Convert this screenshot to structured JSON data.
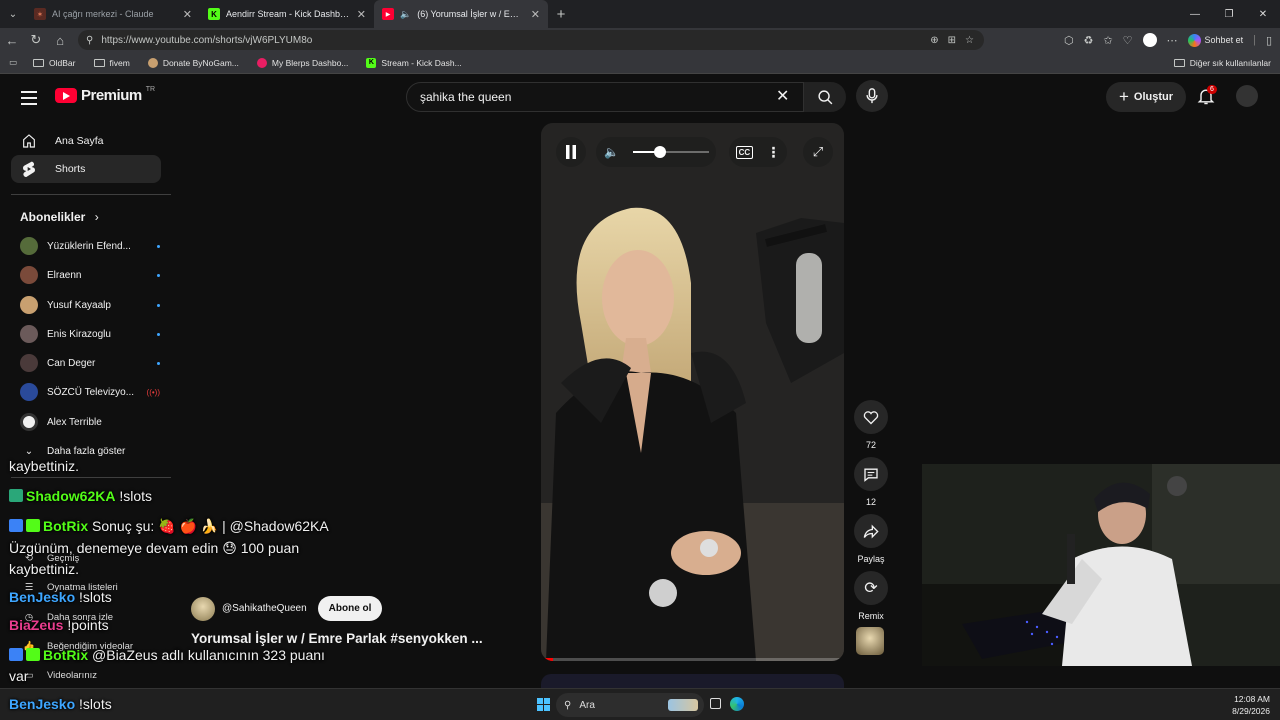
{
  "browser": {
    "tabs": [
      {
        "title": "AI çağrı merkezi - Claude",
        "icon": "claude-icon",
        "active": false
      },
      {
        "title": "Aendirr Stream - Kick Dashboard",
        "icon": "kick-icon",
        "active": false
      },
      {
        "title": "(6) Yorumsal İşler w / Emre Parlak",
        "icon": "youtube-icon",
        "active": true
      }
    ],
    "url": "https://www.youtube.com/shorts/vjW6PLYUM8o",
    "chat_button": "Sohbet et",
    "bookmarks": [
      {
        "label": "OldBar",
        "icon": "folder-icon"
      },
      {
        "label": "fivem",
        "icon": "folder-icon"
      },
      {
        "label": "Donate ByNoGam...",
        "icon": "donate-icon"
      },
      {
        "label": "My Blerps Dashbo...",
        "icon": "blerp-icon"
      },
      {
        "label": "Stream - Kick Dash...",
        "icon": "kick-icon"
      }
    ],
    "other_bookmarks": "Diğer sık kullanılanlar",
    "accent": "#53fc18"
  },
  "youtube": {
    "logo": "Premium",
    "region": "TR",
    "search_query": "şahika the queen",
    "create_label": "Oluştur",
    "notifications": "6",
    "sidebar": {
      "home": "Ana Sayfa",
      "shorts": "Shorts",
      "subscriptions_header": "Abonelikler",
      "subscriptions": [
        {
          "name": "Yüzüklerin Efend...",
          "color": "#556b3a"
        },
        {
          "name": "Elraenn",
          "color": "#7a4a3a"
        },
        {
          "name": "Yusuf Kayaalp",
          "color": "#c8a070"
        },
        {
          "name": "Enis Kirazoglu",
          "color": "#6b5a5a"
        },
        {
          "name": "Can Deger",
          "color": "#4a3a3a"
        },
        {
          "name": "SÖZCÜ Televizyo...",
          "color": "#2a4a9a"
        },
        {
          "name": "Alex Terrible",
          "color": "#f1f1f1"
        }
      ],
      "show_more": "Daha fazla göster",
      "you_items": [
        "Geçmiş",
        "Oynatma listeleri",
        "Daha sonra izle",
        "Beğendiğim videolar",
        "Videolarınız"
      ]
    },
    "short": {
      "channel": "@SahikatheQueen",
      "subscribe_label": "Abone ol",
      "title": "Yorumsal İşler w / Emre Parlak #senyokken ...",
      "likes": "72",
      "comments": "12",
      "share_label": "Paylaş",
      "remix_label": "Remix",
      "volume": 0.35,
      "progress": 0.04
    }
  },
  "chat_overlay": [
    {
      "user": "",
      "text": "kaybettiniz.",
      "color": "#f1f1f1",
      "top": 0
    },
    {
      "user": "Shadow62KA",
      "text": " !slots",
      "color": "#53fc18"
    },
    {
      "user": "BotRix",
      "text": " Sonuç şu: 🍓 🍎 🍌 | @Shadow62KA",
      "color": "#53fc18"
    },
    {
      "user": "",
      "text": "Üzgünüm, denemeye devam edin 😓 100 puan",
      "color": "#f1f1f1"
    },
    {
      "user": "",
      "text": "kaybettiniz.",
      "color": "#f1f1f1"
    },
    {
      "user": "BenJesko",
      "text": " !slots",
      "color": "#3ea6ff"
    },
    {
      "user": "BiaZeus",
      "text": " !points",
      "color": "#e93d8e"
    },
    {
      "user": "BotRix",
      "text": " @BiaZeus adlı kullanıcının 323 puanı",
      "color": "#53fc18"
    },
    {
      "user": "",
      "text": "var",
      "color": "#f1f1f1"
    },
    {
      "user": "BenJesko",
      "text": " !slots",
      "color": "#3ea6ff"
    }
  ],
  "taskbar": {
    "search_placeholder": "Ara",
    "time": "12:08 AM",
    "date": "8/29/2026"
  }
}
